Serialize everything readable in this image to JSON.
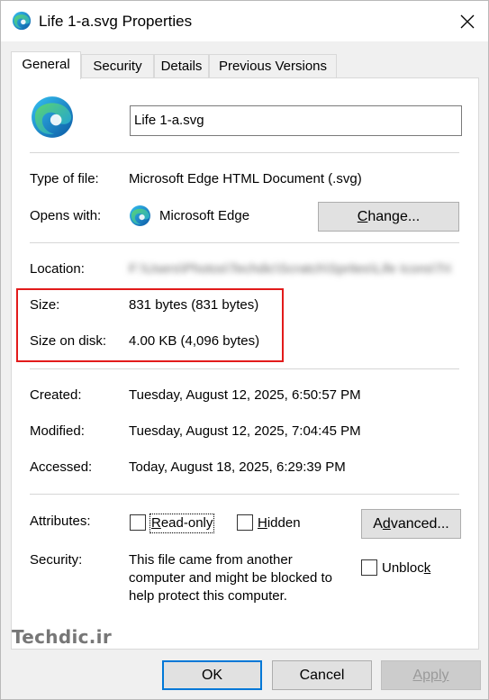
{
  "window": {
    "title": "Life 1-a.svg Properties",
    "close_icon": "close-icon",
    "app_icon": "edge-icon"
  },
  "tabs": [
    {
      "label": "General",
      "active": true
    },
    {
      "label": "Security",
      "active": false
    },
    {
      "label": "Details",
      "active": false
    },
    {
      "label": "Previous Versions",
      "active": false
    }
  ],
  "general": {
    "file_name": "Life 1-a.svg",
    "type_label": "Type of file:",
    "type_value": "Microsoft Edge HTML Document (.svg)",
    "opens_label": "Opens with:",
    "opens_value": "Microsoft Edge",
    "change_button": {
      "pre": "",
      "key": "C",
      "post": "hange..."
    },
    "location_label": "Location:",
    "location_value": "F:\\Users\\Photos\\Techdic\\Scratch\\Sprites\\Life Icons\\Tri",
    "size_label": "Size:",
    "size_value": "831 bytes (831 bytes)",
    "size_on_disk_label": "Size on disk:",
    "size_on_disk_value": "4.00 KB (4,096 bytes)",
    "created_label": "Created:",
    "created_value": "Tuesday, August 12, 2025, 6:50:57 PM",
    "modified_label": "Modified:",
    "modified_value": "Tuesday, August 12, 2025, 7:04:45 PM",
    "accessed_label": "Accessed:",
    "accessed_value": "Today, August 18, 2025, 6:29:39 PM",
    "attributes_label": "Attributes:",
    "readonly": {
      "pre": "",
      "key": "R",
      "post": "ead-only",
      "checked": false
    },
    "hidden": {
      "pre": "",
      "key": "H",
      "post": "idden",
      "checked": false
    },
    "advanced_button": {
      "pre": "A",
      "key": "d",
      "post": "vanced..."
    },
    "security_label": "Security:",
    "security_text": [
      "This file came from another",
      "computer and might be blocked to",
      "help protect this computer."
    ],
    "unblock": {
      "pre": "Unbloc",
      "key": "k",
      "post": "",
      "checked": false
    }
  },
  "buttons": {
    "ok": "OK",
    "cancel": "Cancel",
    "apply": "Apply"
  },
  "watermark": "Techdic.ir",
  "colors": {
    "highlight_box": "#e21b1b",
    "ok_border": "#0078d7",
    "disabled_text": "#9a9a9a"
  }
}
